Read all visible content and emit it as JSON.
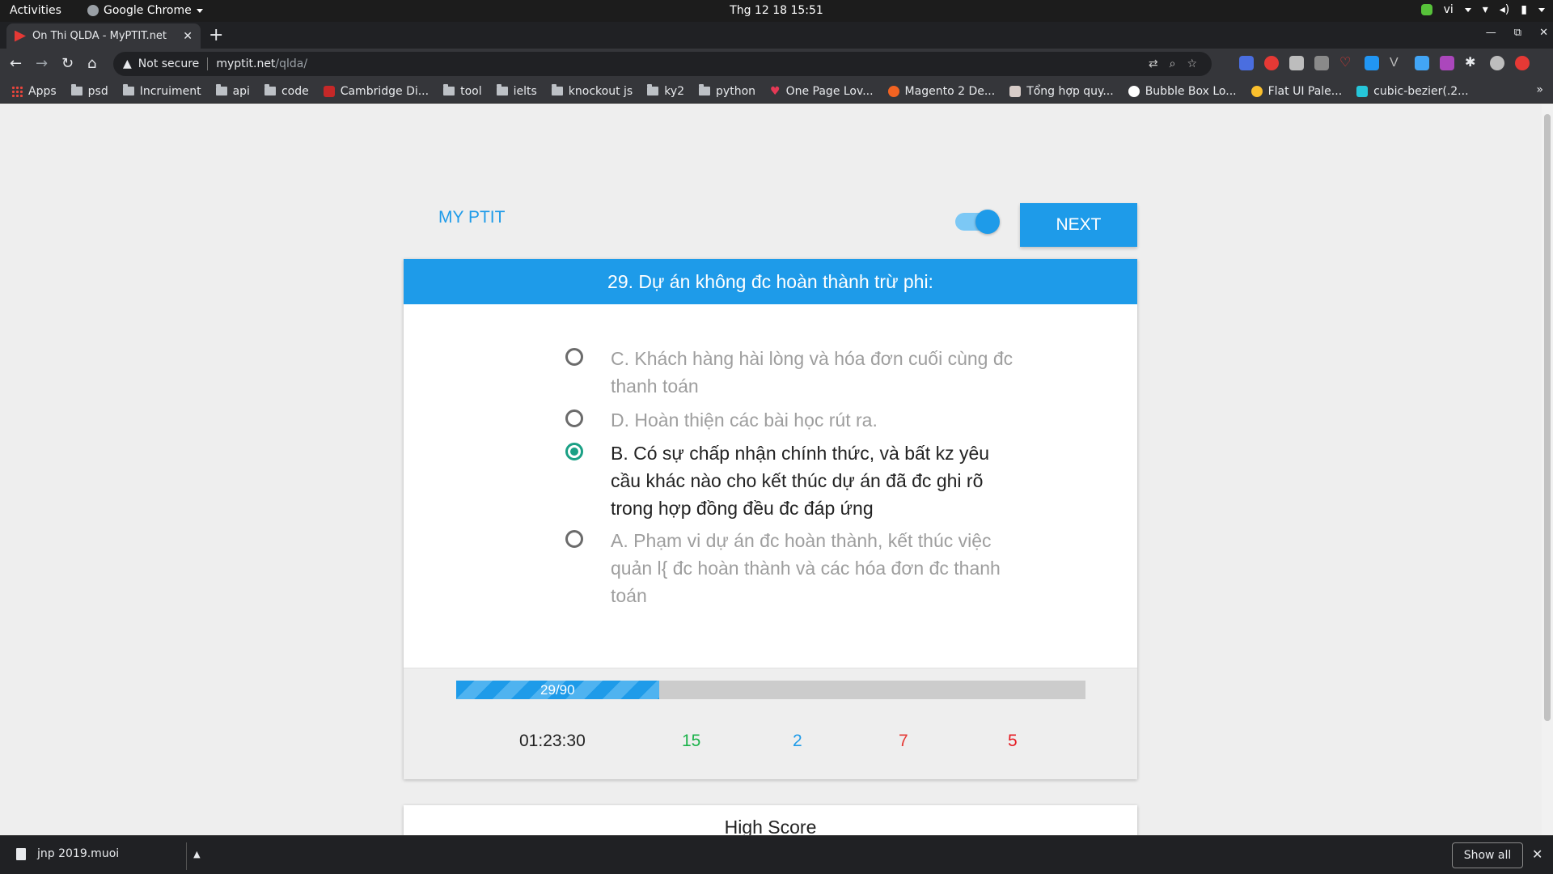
{
  "os_bar": {
    "activities": "Activities",
    "app_name": "Google Chrome",
    "clock": "Thg 12 18  15:51",
    "lang": "vi"
  },
  "browser": {
    "tab_title": "Ôn Thi QLDA - MyPTIT.net",
    "security_label": "Not secure",
    "url_host": "myptit.net",
    "url_path": "/qlda/",
    "bookmarks": [
      "Apps",
      "psd",
      "Incruiment",
      "api",
      "code",
      "Cambridge Di...",
      "tool",
      "ielts",
      "knockout js",
      "ky2",
      "python",
      "One Page Lov...",
      "Magento 2 De...",
      "Tổng hợp quy...",
      "Bubble Box Lo...",
      "Flat UI Pale...",
      "cubic-bezier(.2..."
    ],
    "bookmarks_more": "»"
  },
  "quiz": {
    "logo": "MY PTIT",
    "toggle_on": true,
    "next_label": "NEXT",
    "question": "29. Dự án không đc hoàn thành trừ phi:",
    "options": [
      {
        "text": "C. Khách hàng hài lòng và hóa đơn cuối cùng đc thanh toán",
        "selected": false
      },
      {
        "text": "D. Hoàn thiện các bài học rút ra.",
        "selected": false
      },
      {
        "text": "B. Có sự chấp nhận chính thức, và bất kz yêu cầu khác nào cho kết thúc dự án đã đc ghi rõ trong hợp đồng đều đc đáp ứng",
        "selected": true
      },
      {
        "text": "A. Phạm vi dự án đc hoàn thành, kết thúc việc quản l{ đc hoàn thành và các hóa đơn đc thanh toán",
        "selected": false
      }
    ],
    "progress_label": "29/90",
    "progress_fraction": 0.3222,
    "timer": "01:23:30",
    "stat_green": "15",
    "stat_blue": "2",
    "stat_orange": "7",
    "stat_red": "5",
    "high_score_title": "High Score"
  },
  "downloads": {
    "file_name": "jnp 2019.muoi",
    "show_all": "Show all"
  },
  "colors": {
    "accent": "#1e9be9",
    "radio_selected": "#1aa085",
    "stat_green": "#1bb24a",
    "stat_blue": "#1e9be9",
    "stat_orange": "#e53935",
    "stat_red": "#e51c23"
  }
}
